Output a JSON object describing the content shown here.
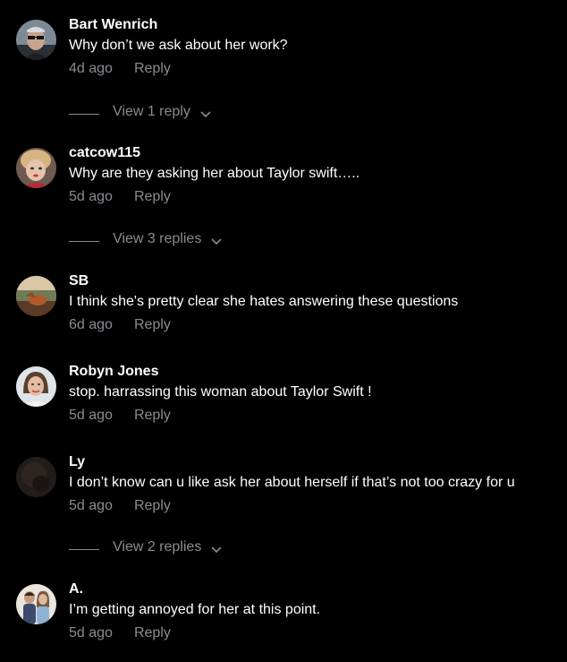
{
  "colors": {
    "background": "#000000",
    "primary_text": "#ffffff",
    "secondary_text": "#8a8b91"
  },
  "comments": [
    {
      "username": "Bart Wenrich",
      "text": "Why don’t we ask about her work?",
      "time": "4d ago",
      "reply_label": "Reply",
      "avatar_icon": "avatar-man-sunglasses",
      "view_replies": "View 1 reply"
    },
    {
      "username": "catcow115",
      "text": "Why are they asking her about Taylor swift…..",
      "time": "5d ago",
      "reply_label": "Reply",
      "avatar_icon": "avatar-doll",
      "view_replies": "View 3 replies"
    },
    {
      "username": "SB",
      "text": "I think she's pretty clear she hates answering these questions",
      "time": "6d ago",
      "reply_label": "Reply",
      "avatar_icon": "avatar-landscape-sunset"
    },
    {
      "username": "Robyn Jones",
      "text": "stop. harrassing this woman about Taylor Swift !",
      "time": "5d ago",
      "reply_label": "Reply",
      "avatar_icon": "avatar-woman"
    },
    {
      "username": "Ly",
      "text": "I don’t know can u like ask her about herself if that’s not too crazy for u",
      "time": "5d ago",
      "reply_label": "Reply",
      "avatar_icon": "avatar-dark",
      "view_replies": "View 2 replies"
    },
    {
      "username": "A.",
      "text": "I’m getting annoyed for her at this point.",
      "time": "5d ago",
      "reply_label": "Reply",
      "avatar_icon": "avatar-couple"
    }
  ]
}
